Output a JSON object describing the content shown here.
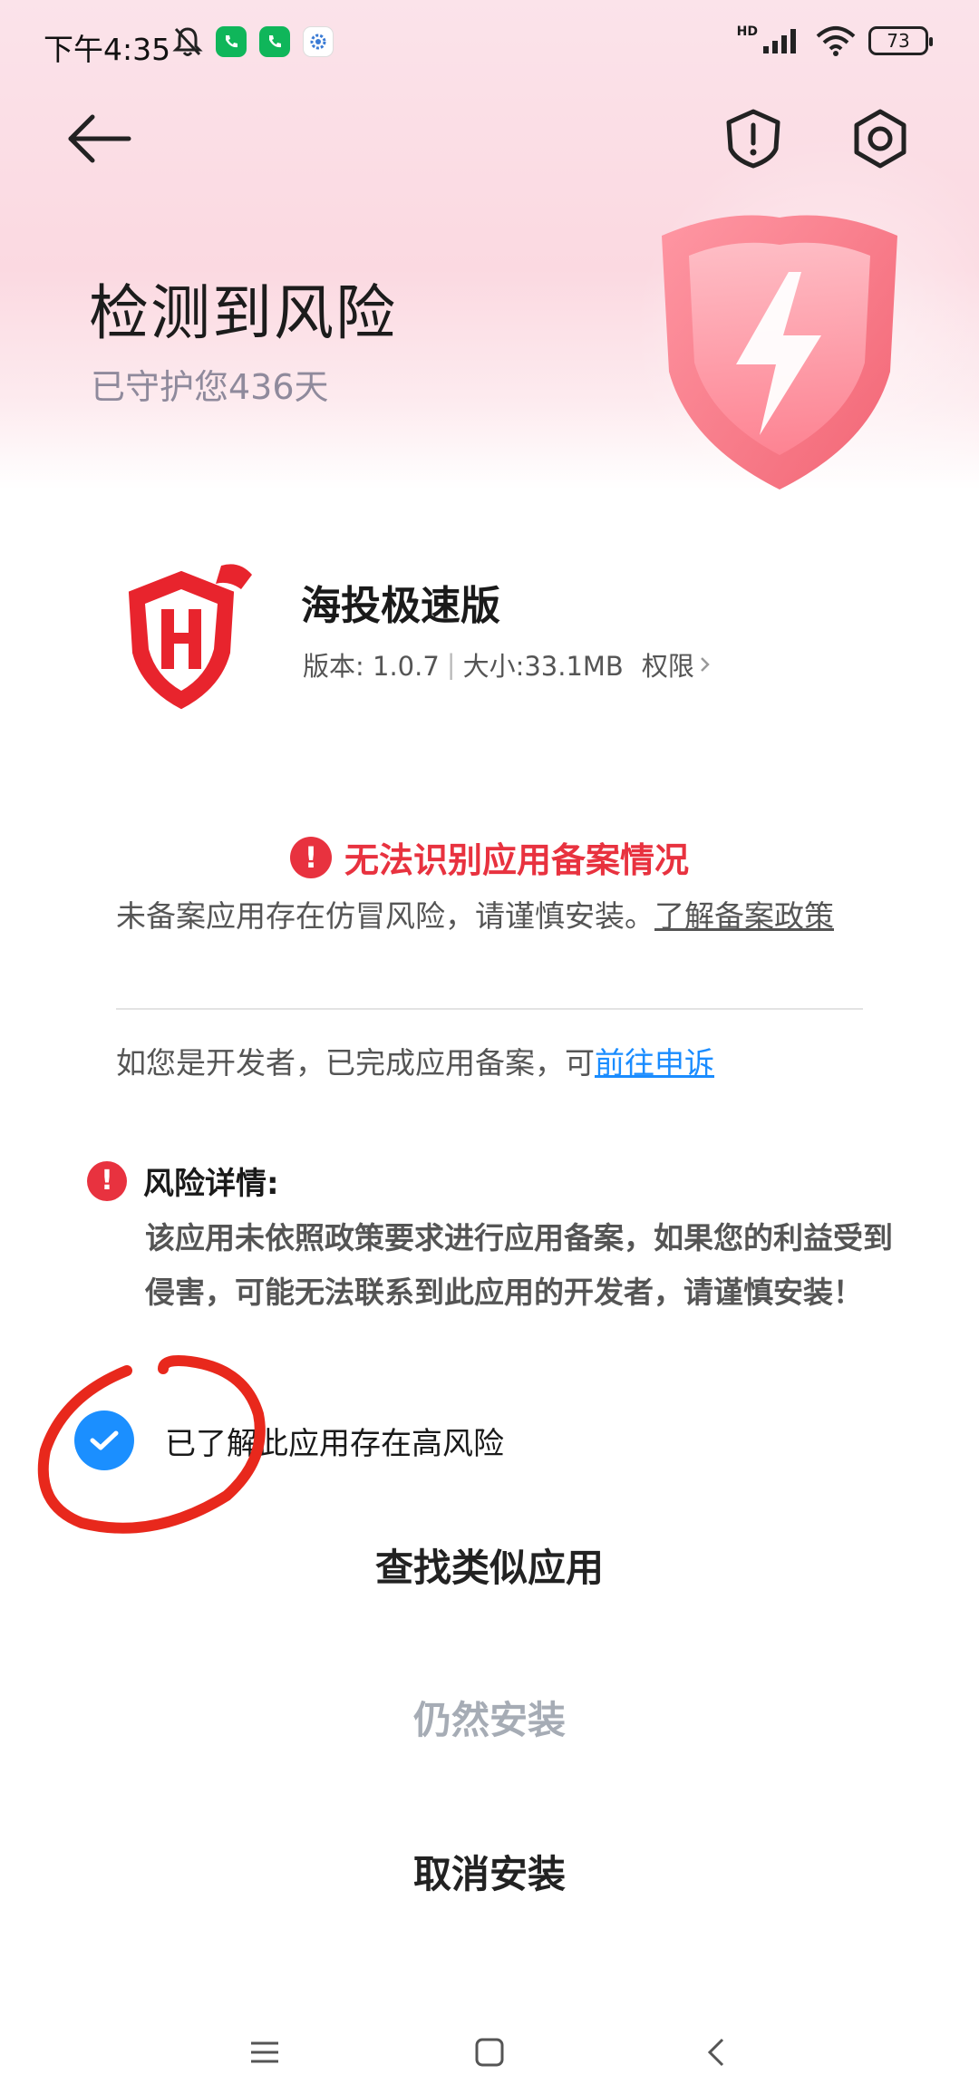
{
  "status_bar": {
    "time": "下午4:35",
    "network_badge": "HD",
    "battery": "73"
  },
  "header": {
    "title": "检测到风险",
    "subtitle": "已守护您436天"
  },
  "app": {
    "name": "海投极速版",
    "version": "版本: 1.0.7",
    "size": "大小:33.1MB",
    "permissions_link": "权限"
  },
  "risk": {
    "headline": "无法识别应用备案情况",
    "notice_text": "未备案应用存在仿冒风险，请谨慎安装。",
    "notice_link": "了解备案政策",
    "developer_text": "如您是开发者，已完成应用备案，可",
    "developer_link": "前往申诉",
    "details_title": "风险详情:",
    "details_body": "该应用未依照政策要求进行应用备案，如果您的利益受到侵害，可能无法联系到此应用的开发者，请谨慎安装！"
  },
  "acknowledge": {
    "label": "已了解此应用存在高风险",
    "checked": true
  },
  "actions": {
    "find_similar": "查找类似应用",
    "install_anyway": "仍然安装",
    "cancel_install": "取消安装"
  },
  "colors": {
    "danger": "#e8323f",
    "link": "#1a8cff",
    "checkbox": "#1b8fff",
    "annotation": "#e8281c"
  }
}
